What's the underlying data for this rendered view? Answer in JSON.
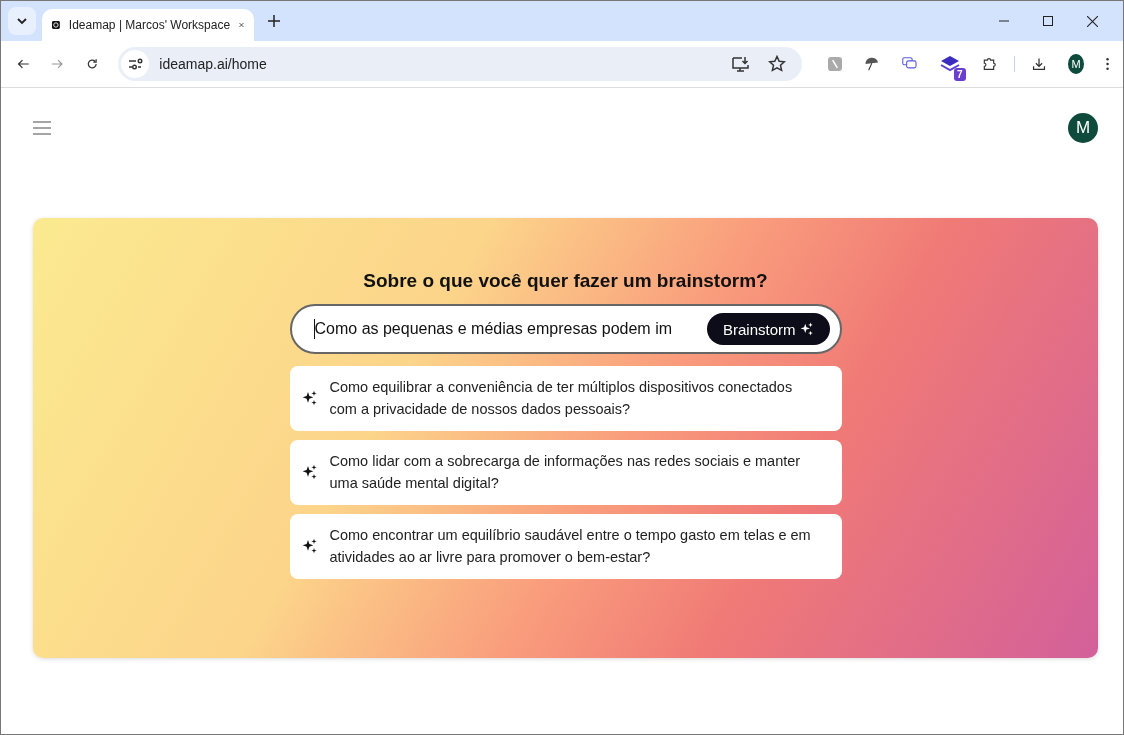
{
  "browser": {
    "tab_title": "Ideamap | Marcos' Workspace",
    "url": "ideamap.ai/home",
    "extension_badge": "7",
    "profile_initial": "M"
  },
  "page": {
    "avatar_initial": "M",
    "heading": "Sobre o que você quer fazer um brainstorm?",
    "input_value": "Como as pequenas e médias empresas podem im",
    "button_label": "Brainstorm",
    "suggestions": [
      {
        "text": "Como equilibrar a conveniência de ter múltiplos dispositivos conectados com a privacidade de nossos dados pessoais?"
      },
      {
        "text": "Como lidar com a sobrecarga de informações nas redes sociais e manter uma saúde mental digital?"
      },
      {
        "text": "Como encontrar um equilíbrio saudável entre o tempo gasto em telas e em atividades ao ar livre para promover o bem-estar?"
      }
    ]
  }
}
